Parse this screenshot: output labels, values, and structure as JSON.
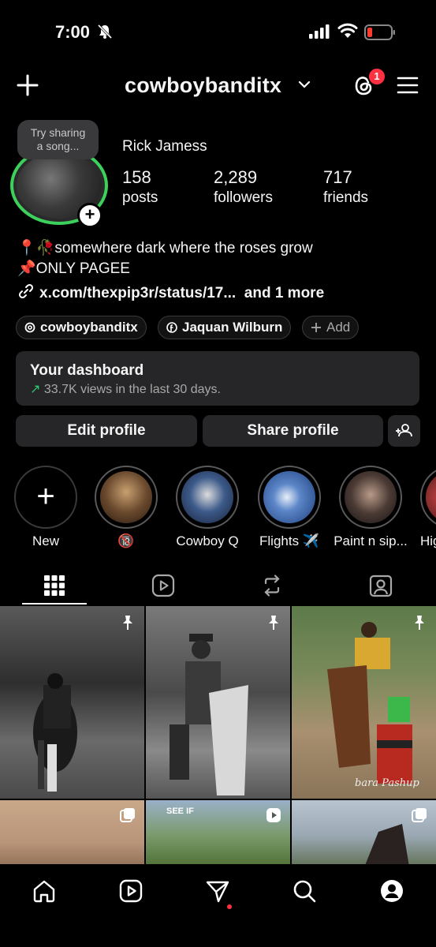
{
  "status_bar": {
    "time": "7:00"
  },
  "header": {
    "username": "cowboybanditx",
    "notification_count": "1"
  },
  "profile": {
    "note": [
      "Try sharing",
      "a song..."
    ],
    "display_name": "Rick Jamess",
    "stats": [
      {
        "value": "158",
        "label": "posts"
      },
      {
        "value": "2,289",
        "label": "followers"
      },
      {
        "value": "717",
        "label": "friends"
      }
    ],
    "bio_line1": "📍🥀somewhere dark where the roses grow",
    "bio_line2": "📌ONLY PAGEE",
    "link_text": "x.com/thexpip3r/status/17...",
    "link_more": "and 1 more",
    "chips": [
      "cowboybanditx",
      "Jaquan Wilburn",
      "Add"
    ]
  },
  "dashboard": {
    "title": "Your dashboard",
    "subtitle": "33.7K views in the last 30 days."
  },
  "buttons": {
    "edit": "Edit profile",
    "share": "Share profile"
  },
  "highlights": [
    {
      "label": "New"
    },
    {
      "label": "🔞"
    },
    {
      "label": "Cowboy Q"
    },
    {
      "label": "Flights ✈️"
    },
    {
      "label": "Paint n sip..."
    },
    {
      "label": "Hig"
    }
  ],
  "grid_captions": {
    "post5": "SEE IF",
    "post3_watermark": "bara Pashup"
  },
  "colors": {
    "background": "#000000",
    "story_ring": "#3cd15b",
    "badge": "#ff3040",
    "card": "#262628"
  }
}
